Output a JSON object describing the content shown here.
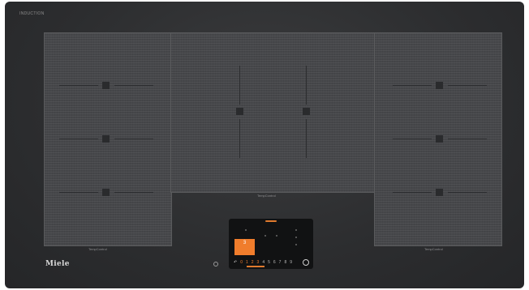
{
  "hob": {
    "top_brand": "INDUCTION",
    "logo": "Miele",
    "zones": {
      "left_label": "TempControl",
      "center_label": "TempControl",
      "right_label": "TempControl"
    }
  },
  "control_panel": {
    "active_level": "3",
    "active_sub": "",
    "scale": [
      "0",
      "1",
      "2",
      "3",
      "4",
      "5",
      "6",
      "7",
      "8",
      "9"
    ],
    "selected_level": 3,
    "colors": {
      "accent": "#f07d2c",
      "panel": "#111213",
      "zone": "#46474a"
    },
    "icons": [
      "back-icon",
      "power-icon",
      "info-icon"
    ]
  }
}
